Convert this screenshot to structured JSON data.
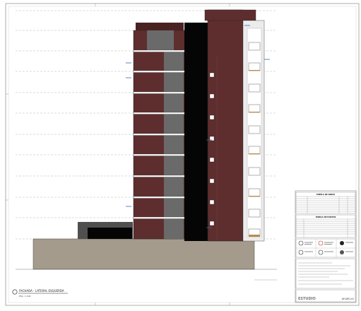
{
  "drawing": {
    "view_title": "FACHADA - LATERAL ESQUERDA",
    "scale_note": "ESC. 1:100",
    "frame_marks_left": [
      "1",
      "2",
      "3",
      "4"
    ],
    "frame_marks_top": [
      "A",
      "B",
      "C",
      "D",
      "E"
    ],
    "colors": {
      "brick": "#5e2e2e",
      "brick_dark": "#4a2222",
      "concrete": "#a49b8d",
      "window_grey": "#6a6a6a",
      "black_panel": "#050505",
      "outline": "#222222",
      "dashed_level": "#9a9a9a",
      "label_blue": "#2d6bb0"
    }
  },
  "title_block": {
    "table1_title": "TABELA DE AREAS",
    "table2_title": "TABELA DE PONTOS",
    "footer_logo": "ESTUDIO",
    "footer_code": "AP-ARQ-01"
  }
}
